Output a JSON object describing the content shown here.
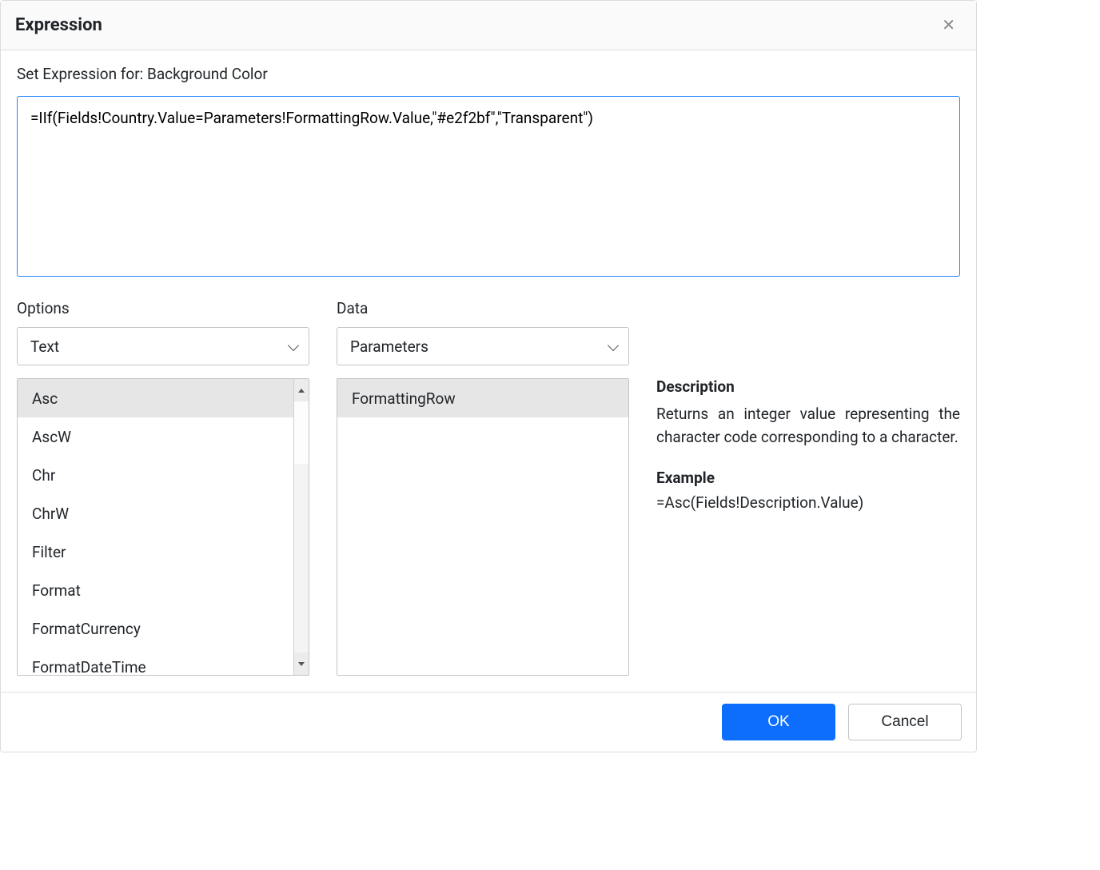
{
  "dialog": {
    "title": "Expression",
    "subtitle": "Set Expression for: Background Color",
    "expression_value": "=IIf(Fields!Country.Value=Parameters!FormattingRow.Value,\"#e2f2bf\",\"Transparent\")"
  },
  "options": {
    "label": "Options",
    "selected": "Text",
    "items": [
      "Asc",
      "AscW",
      "Chr",
      "ChrW",
      "Filter",
      "Format",
      "FormatCurrency",
      "FormatDateTime"
    ],
    "selected_item_index": 0
  },
  "data": {
    "label": "Data",
    "selected": "Parameters",
    "items": [
      "FormattingRow"
    ],
    "selected_item_index": 0
  },
  "description": {
    "heading": "Description",
    "text": "Returns an integer value representing the character code corresponding to a character.",
    "example_heading": "Example",
    "example_text": "=Asc(Fields!Description.Value)"
  },
  "footer": {
    "ok": "OK",
    "cancel": "Cancel"
  }
}
